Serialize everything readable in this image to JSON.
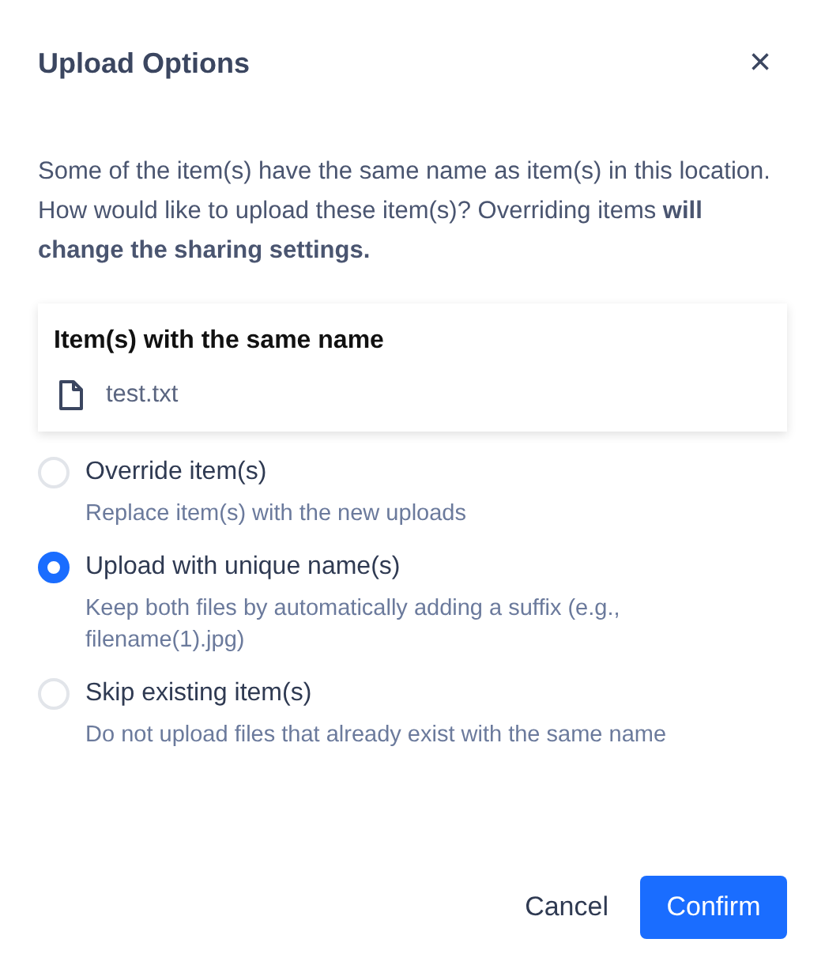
{
  "dialog": {
    "title": "Upload Options",
    "close": "×"
  },
  "message": "Some of the item(s) have the same name as item(s) in this location. How would like to upload these item(s)? Overriding items **will change the sharing settings.**",
  "conflicts": {
    "heading": "Item(s) with the same name",
    "files": [
      "test.txt"
    ]
  },
  "options": [
    {
      "label": "Override item(s)",
      "description": "Replace item(s) with the new uploads",
      "selected": false
    },
    {
      "label": "Upload with unique name(s)",
      "description": "Keep both files by automatically adding a suffix (e.g., filename(1).jpg)",
      "selected": true
    },
    {
      "label": "Skip existing item(s)",
      "description": "Do not upload files that already exist with the same name",
      "selected": false
    }
  ],
  "buttons": {
    "cancel": "Cancel",
    "confirm": "Confirm"
  }
}
